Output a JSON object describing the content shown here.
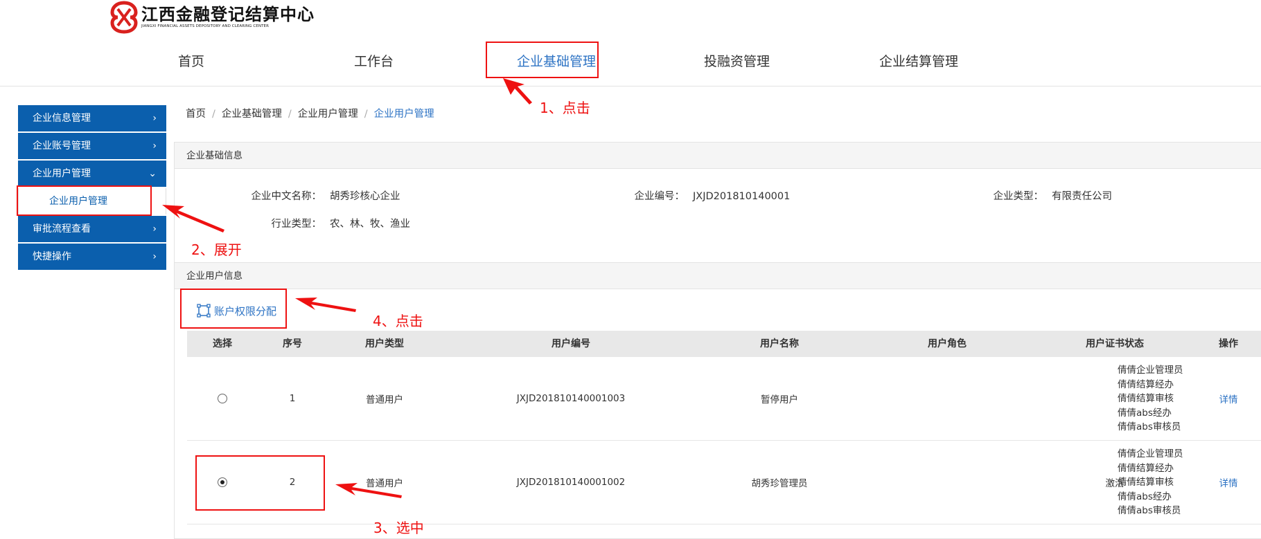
{
  "logo": {
    "cn": "江西金融登记结算中心",
    "en": "JIANGXI FINANCIAL ASSETS DEPOSITORY AND CLEARING CENTER"
  },
  "nav": {
    "home": "首页",
    "workbench": "工作台",
    "enterprise_basic": "企业基础管理",
    "investment": "投融资管理",
    "settlement": "企业结算管理"
  },
  "sidebar": {
    "info_mgmt": "企业信息管理",
    "account_mgmt": "企业账号管理",
    "user_mgmt": "企业用户管理",
    "user_mgmt_sub": "企业用户管理",
    "approval": "审批流程查看",
    "quick_ops": "快捷操作"
  },
  "breadcrumb": {
    "b1": "首页",
    "b2": "企业基础管理",
    "b3": "企业用户管理",
    "b4": "企业用户管理"
  },
  "basic_info": {
    "title": "企业基础信息",
    "name_label": "企业中文名称：",
    "name_value": "胡秀珍核心企业",
    "code_label": "企业编号：",
    "code_value": "JXJD201810140001",
    "type_label": "企业类型：",
    "type_value": "有限责任公司",
    "industry_label": "行业类型：",
    "industry_value": "农、林、牧、渔业"
  },
  "user_info": {
    "title": "企业用户信息",
    "perm_button": "账户权限分配",
    "columns": {
      "select": "选择",
      "seq": "序号",
      "type": "用户类型",
      "code": "用户编号",
      "name": "用户名称",
      "role": "用户角色",
      "cert": "用户证书状态",
      "op": "操作"
    },
    "rows": [
      {
        "seq": "1",
        "type": "普通用户",
        "code": "JXJD201810140001003",
        "name": "暂停用户",
        "roles": [
          "倩倩企业管理员",
          "倩倩结算经办",
          "倩倩结算审核",
          "倩倩abs经办",
          "倩倩abs审核员"
        ],
        "cert": "",
        "op": "详情",
        "selected": false
      },
      {
        "seq": "2",
        "type": "普通用户",
        "code": "JXJD201810140001002",
        "name": "胡秀珍管理员",
        "roles": [
          "倩倩企业管理员",
          "倩倩结算经办",
          "倩倩结算审核",
          "倩倩abs经办",
          "倩倩abs审核员"
        ],
        "cert": "激活",
        "op": "详情",
        "selected": true
      }
    ]
  },
  "annotations": {
    "step1": "1、点击",
    "step2": "2、展开",
    "step3": "3、选中",
    "step4": "4、点击"
  },
  "colors": {
    "primary_blue": "#0b5fad",
    "link_blue": "#2d73c4",
    "annotation_red": "#ee1111",
    "logo_red": "#d9211e"
  }
}
